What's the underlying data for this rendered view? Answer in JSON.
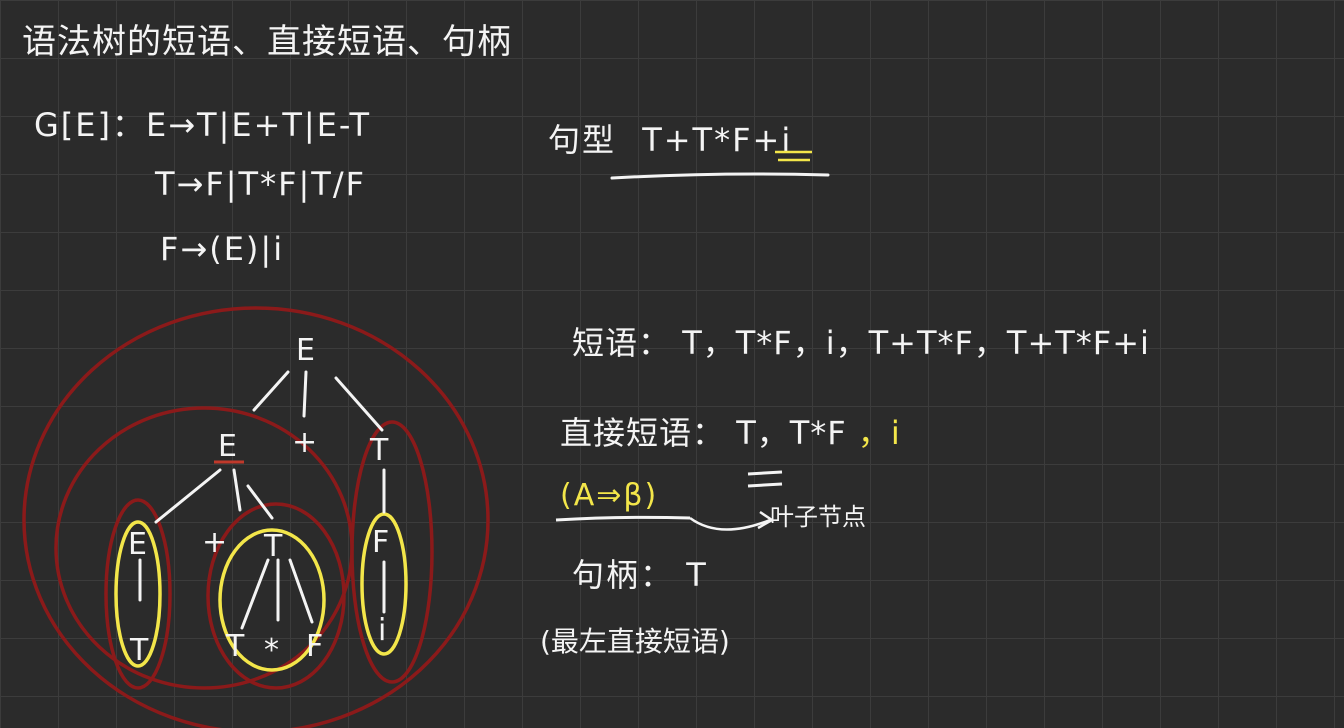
{
  "title": "语法树的短语、直接短语、句柄",
  "grammar": {
    "line1": "G[E]：E→T|E+T|E-T",
    "line2": "T→F|T*F|T/F",
    "line3": "F→(E)|i"
  },
  "sentential_form": {
    "label": "句型",
    "value": "T+T*F+i"
  },
  "phrases": {
    "label": "短语：",
    "value": "T，T*F，i，T+T*F，T+T*F+i"
  },
  "simple_phrases": {
    "label": "直接短语：",
    "value": "T，T*F",
    "extra": "，i"
  },
  "derivation_note": "(A⇒β)",
  "leaf_note": "叶子节点",
  "handle": {
    "label": "句柄：",
    "value": "T"
  },
  "handle_note": "(最左直接短语)",
  "tree": {
    "root": "E",
    "l1_left": "E",
    "l1_mid": "+",
    "l1_right": "T",
    "l2_a": "E",
    "l2_b": "+",
    "l2_c": "T",
    "l2_d": "F",
    "l3_a": "T",
    "l3_b": "T",
    "l3_c": "*",
    "l3_d": "F",
    "l3_e": "i"
  },
  "colors": {
    "background": "#2b2b2b",
    "ink": "#f4f4f4",
    "red_circle": "#8b1a1a",
    "yellow_circle": "#f3e64a"
  }
}
